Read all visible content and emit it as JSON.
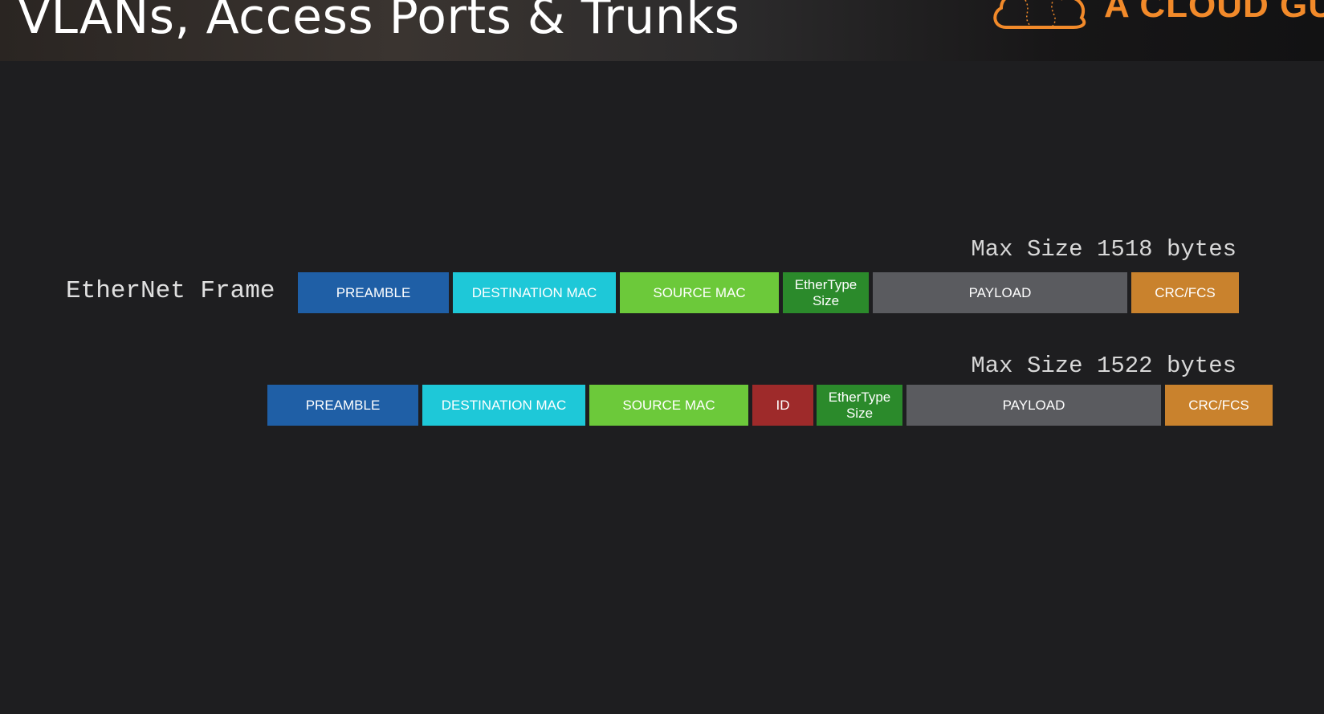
{
  "header": {
    "title": "VLANs, Access Ports & Trunks",
    "brand": "A CLOUD GURU"
  },
  "frame1": {
    "label": "EtherNet Frame",
    "max_size": "Max Size 1518 bytes",
    "fields": {
      "preamble": "PREAMBLE",
      "destination_mac": "DESTINATION MAC",
      "source_mac": "SOURCE MAC",
      "ethertype_line1": "EtherType",
      "ethertype_line2": "Size",
      "payload": "PAYLOAD",
      "crc": "CRC/FCS"
    }
  },
  "frame2": {
    "max_size": "Max Size 1522 bytes",
    "fields": {
      "preamble": "PREAMBLE",
      "destination_mac": "DESTINATION MAC",
      "source_mac": "SOURCE MAC",
      "id": "ID",
      "ethertype_line1": "EtherType",
      "ethertype_line2": "Size",
      "payload": "PAYLOAD",
      "crc": "CRC/FCS"
    }
  },
  "colors": {
    "preamble": "#1f5fa6",
    "destination_mac": "#1ec8d8",
    "source_mac": "#6cc93a",
    "ethertype": "#2b8a2b",
    "payload": "#5a5b5f",
    "crc": "#c9822d",
    "id": "#9e2a2a",
    "brand": "#f28a2a"
  }
}
